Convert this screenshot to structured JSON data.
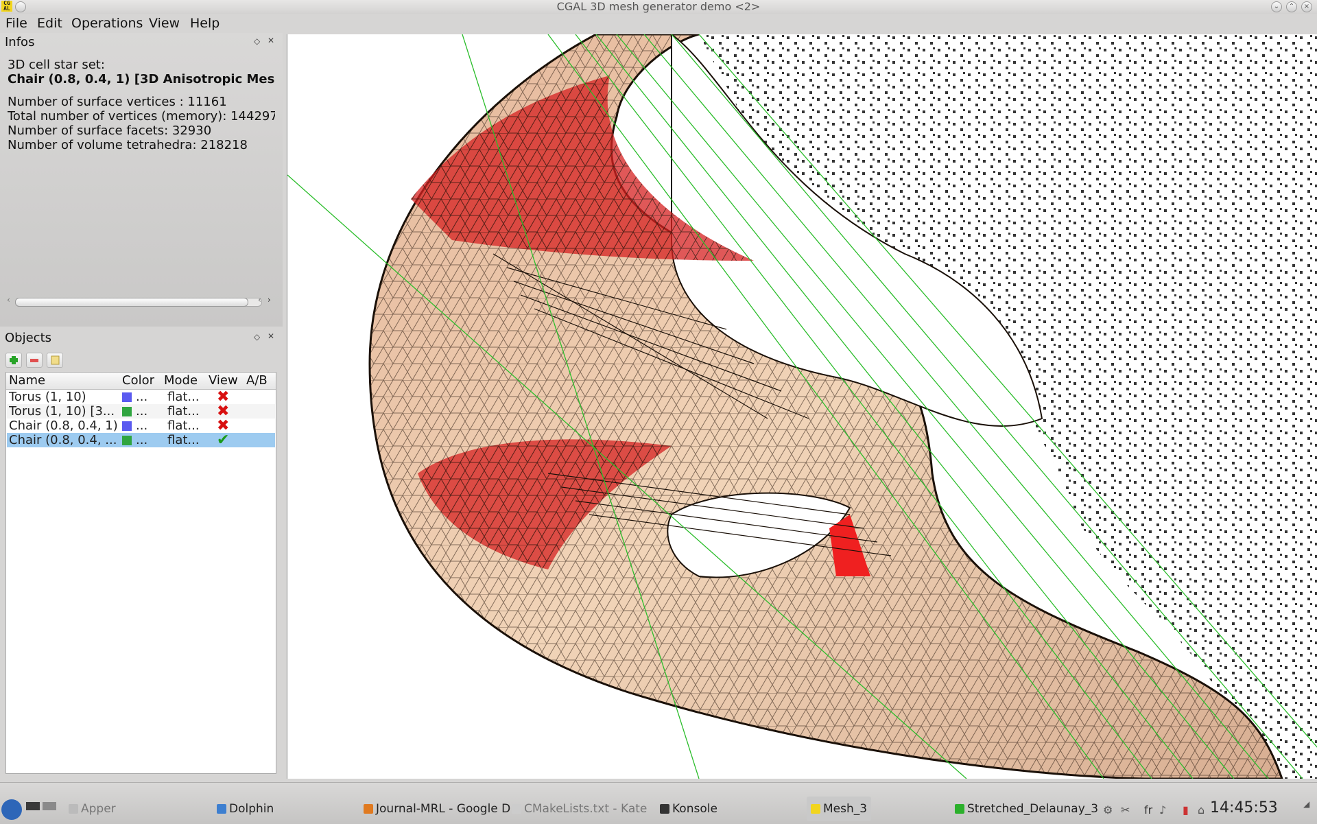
{
  "window": {
    "title": "CGAL 3D mesh generator demo <2>",
    "app_icon_text": "CG AL"
  },
  "menu": {
    "file": "File",
    "edit": "Edit",
    "operations": "Operations",
    "view": "View",
    "help": "Help"
  },
  "infos": {
    "title": "Infos",
    "line1": "3D cell star set:",
    "line2": "Chair (0.8, 0.4, 1) [3D Anisotropic Mes",
    "stats": [
      "Number of surface vertices : 11161",
      "Total number of vertices (memory): 144297",
      "Number of surface facets: 32930",
      "Number of volume tetrahedra: 218218"
    ]
  },
  "objects": {
    "title": "Objects",
    "headers": {
      "name": "Name",
      "color": "Color",
      "mode": "Mode",
      "view": "View",
      "ab": "A/B"
    },
    "rows": [
      {
        "name": "Torus (1, 10)",
        "color_hex": "#5a5af0",
        "color_text": "...",
        "mode": "flat...",
        "view_icon": "red-x-icon",
        "view": false
      },
      {
        "name": "Torus (1, 10) [3...",
        "color_hex": "#30a540",
        "color_text": "...",
        "mode": "flat...",
        "view_icon": "red-x-icon",
        "view": false
      },
      {
        "name": "Chair (0.8, 0.4, 1)",
        "color_hex": "#5a5af0",
        "color_text": "...",
        "mode": "flat...",
        "view_icon": "red-x-icon",
        "view": false
      },
      {
        "name": "Chair (0.8, 0.4, ...",
        "color_hex": "#30a540",
        "color_text": "...",
        "mode": "flat...",
        "view_icon": "green-check-icon",
        "view": true
      }
    ]
  },
  "colors": {
    "selection": "#9dcbf0",
    "mesh_fill": "#e8c4a4",
    "mesh_red": "#e02222",
    "green_lines": "#2bbd2b"
  },
  "taskbar": {
    "tasks": [
      "Apper",
      "Dolphin",
      "Journal-MRL - Google D",
      "CMakeLists.txt - Kate",
      "Konsole",
      "Mesh_3",
      "Stretched_Delaunay_3"
    ],
    "keyboard_layout": "fr",
    "clock": "14:45:53"
  }
}
